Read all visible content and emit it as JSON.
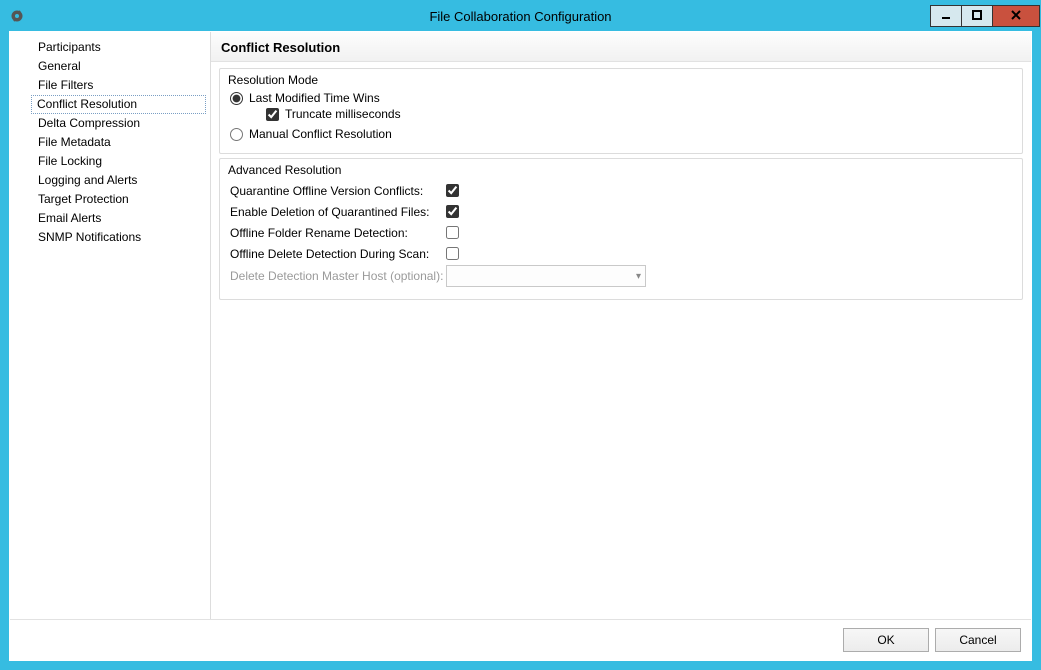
{
  "window": {
    "title": "File Collaboration Configuration"
  },
  "sidebar": {
    "items": [
      {
        "label": "Participants",
        "selected": false
      },
      {
        "label": "General",
        "selected": false
      },
      {
        "label": "File Filters",
        "selected": false
      },
      {
        "label": "Conflict Resolution",
        "selected": true
      },
      {
        "label": "Delta Compression",
        "selected": false
      },
      {
        "label": "File Metadata",
        "selected": false
      },
      {
        "label": "File Locking",
        "selected": false
      },
      {
        "label": "Logging and Alerts",
        "selected": false
      },
      {
        "label": "Target Protection",
        "selected": false
      },
      {
        "label": "Email Alerts",
        "selected": false
      },
      {
        "label": "SNMP Notifications",
        "selected": false
      }
    ]
  },
  "page": {
    "title": "Conflict Resolution",
    "resolution_mode": {
      "group_label": "Resolution Mode",
      "last_modified": {
        "label": "Last Modified Time Wins",
        "selected": true,
        "truncate_label": "Truncate milliseconds",
        "truncate_checked": true
      },
      "manual": {
        "label": "Manual Conflict Resolution",
        "selected": false
      }
    },
    "advanced": {
      "group_label": "Advanced Resolution",
      "rows": [
        {
          "label": "Quarantine Offline Version Conflicts:",
          "checked": true
        },
        {
          "label": "Enable Deletion of Quarantined Files:",
          "checked": true
        },
        {
          "label": "Offline Folder Rename Detection:",
          "checked": false
        },
        {
          "label": "Offline Delete Detection During Scan:",
          "checked": false
        }
      ],
      "master_host_label": "Delete Detection Master Host (optional):",
      "master_host_value": "",
      "master_host_disabled": true
    }
  },
  "footer": {
    "ok": "OK",
    "cancel": "Cancel"
  }
}
